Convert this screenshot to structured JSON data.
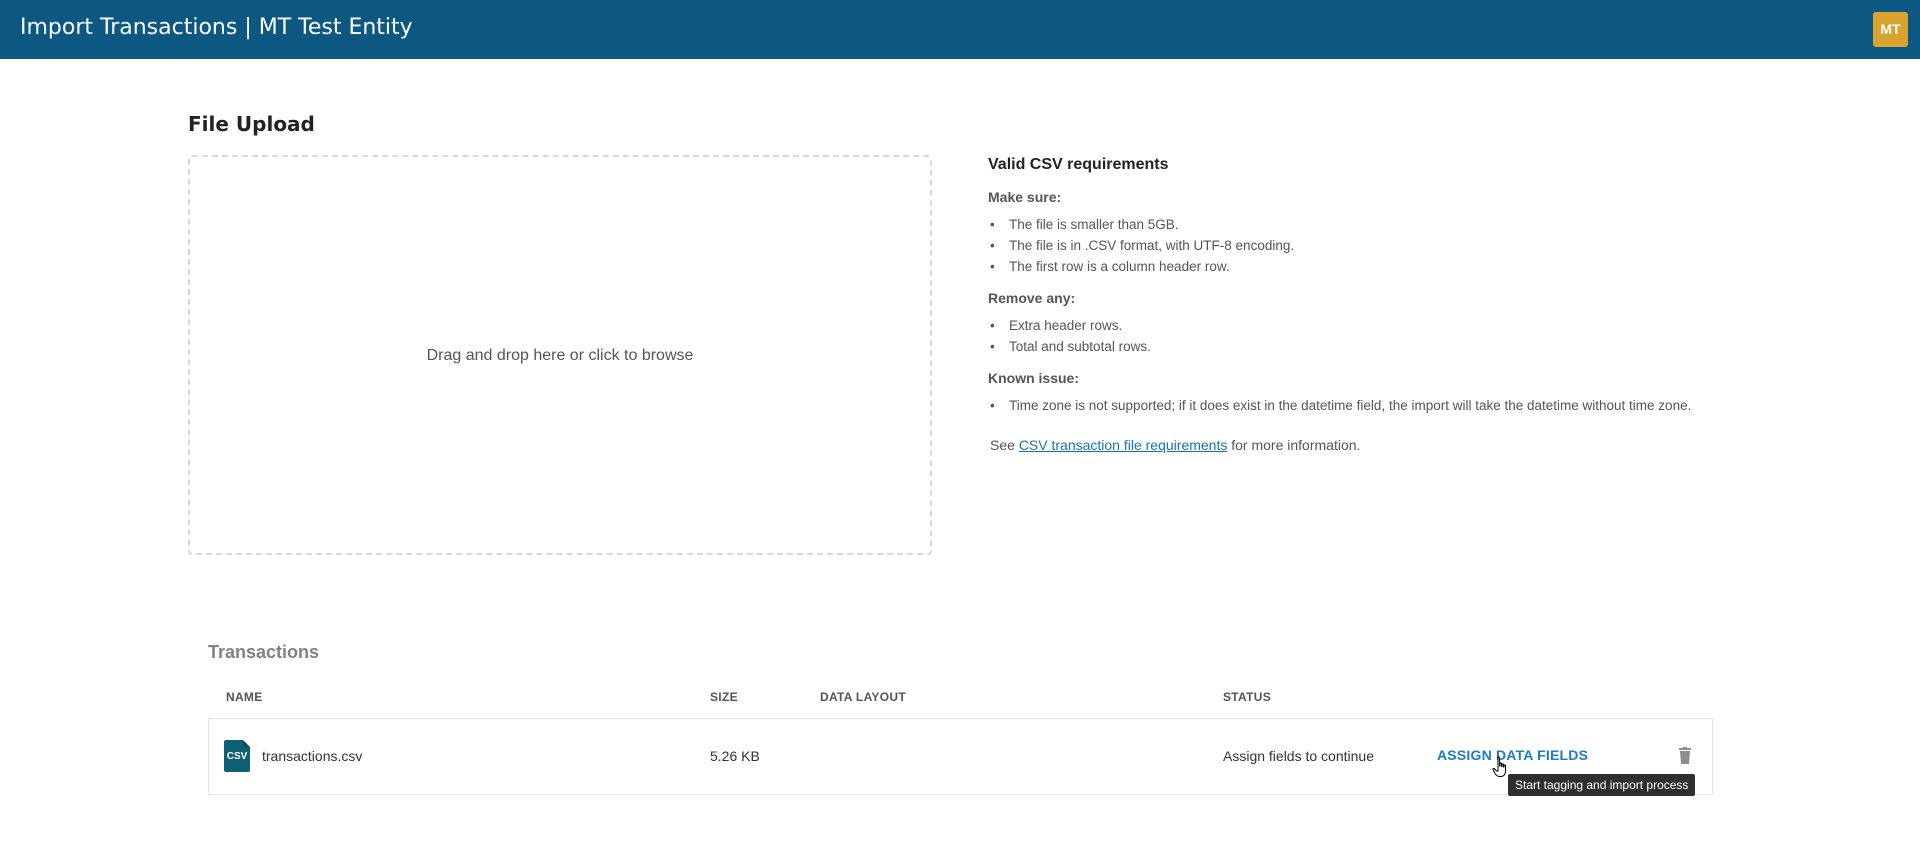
{
  "header": {
    "title": "Import Transactions | MT Test Entity",
    "avatar_initials": "MT",
    "background_color": "#0c5883",
    "avatar_color": "#d9a32d"
  },
  "upload": {
    "section_title": "File Upload",
    "dropzone_text": "Drag and drop here or click to browse"
  },
  "requirements": {
    "title": "Valid CSV requirements",
    "make_sure_label": "Make sure:",
    "make_sure_items": [
      "The file is smaller than 5GB.",
      "The file is in .CSV format, with UTF-8 encoding.",
      "The first row is a column header row."
    ],
    "remove_any_label": "Remove any:",
    "remove_any_items": [
      "Extra header rows.",
      "Total and subtotal rows."
    ],
    "known_issue_label": "Known issue:",
    "known_issue_items": [
      "Time zone is not supported; if it does exist in the datetime field, the import will take the datetime without time zone."
    ],
    "see_prefix": "See",
    "see_link": "CSV transaction file requirements",
    "see_suffix": "for more information."
  },
  "transactions": {
    "title": "Transactions",
    "columns": [
      "NAME",
      "SIZE",
      "DATA LAYOUT",
      "STATUS"
    ],
    "rows": [
      {
        "file_icon_label": "CSV",
        "name": "transactions.csv",
        "size": "5.26 KB",
        "data_layout": "",
        "status": "Assign fields to continue",
        "action": "ASSIGN DATA FIELDS",
        "action_tooltip": "Start tagging and import process",
        "icon": "csv-file-icon",
        "delete_icon": "trash-icon"
      }
    ],
    "action_color": "#1a7cc4"
  }
}
